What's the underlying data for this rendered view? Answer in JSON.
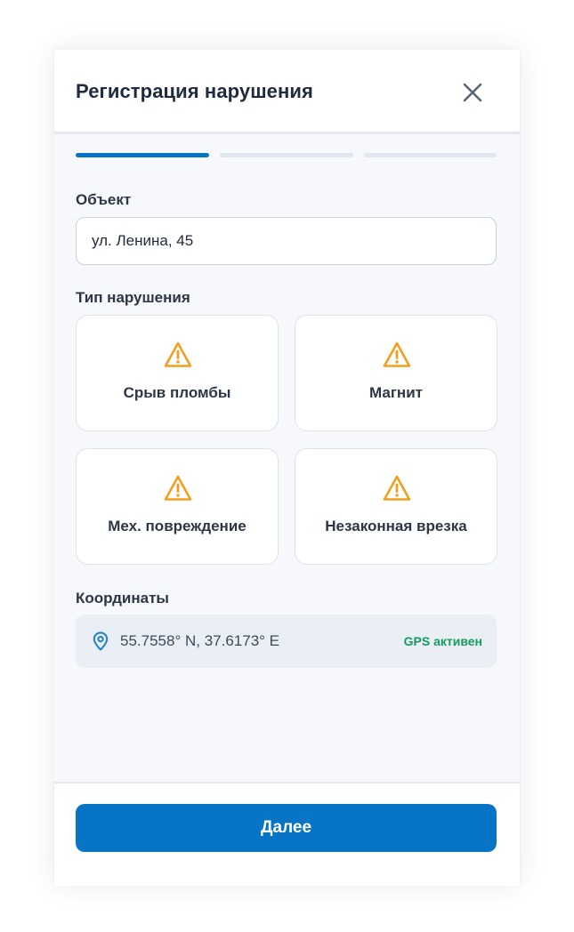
{
  "dialog": {
    "title": "Регистрация нарушения",
    "close_icon": "close-icon"
  },
  "progress": {
    "current_step": 1,
    "total_steps": 3,
    "active_color": "#0874c6",
    "inactive_color": "#e1e7ee"
  },
  "object": {
    "label": "Объект",
    "value": "ул. Ленина, 45"
  },
  "violation_type": {
    "label": "Тип нарушения",
    "icon": "warning-triangle-icon",
    "icon_color": "#f0a020",
    "options": [
      {
        "label": "Срыв пломбы"
      },
      {
        "label": "Магнит"
      },
      {
        "label": "Мех. повреждение"
      },
      {
        "label": "Незаконная врезка"
      }
    ]
  },
  "coordinates": {
    "label": "Координаты",
    "icon": "location-pin-icon",
    "value": "55.7558° N, 37.6173° E",
    "status": "GPS активен",
    "status_color": "#179a60"
  },
  "footer": {
    "next_label": "Далее",
    "accent_color": "#0874c6"
  }
}
